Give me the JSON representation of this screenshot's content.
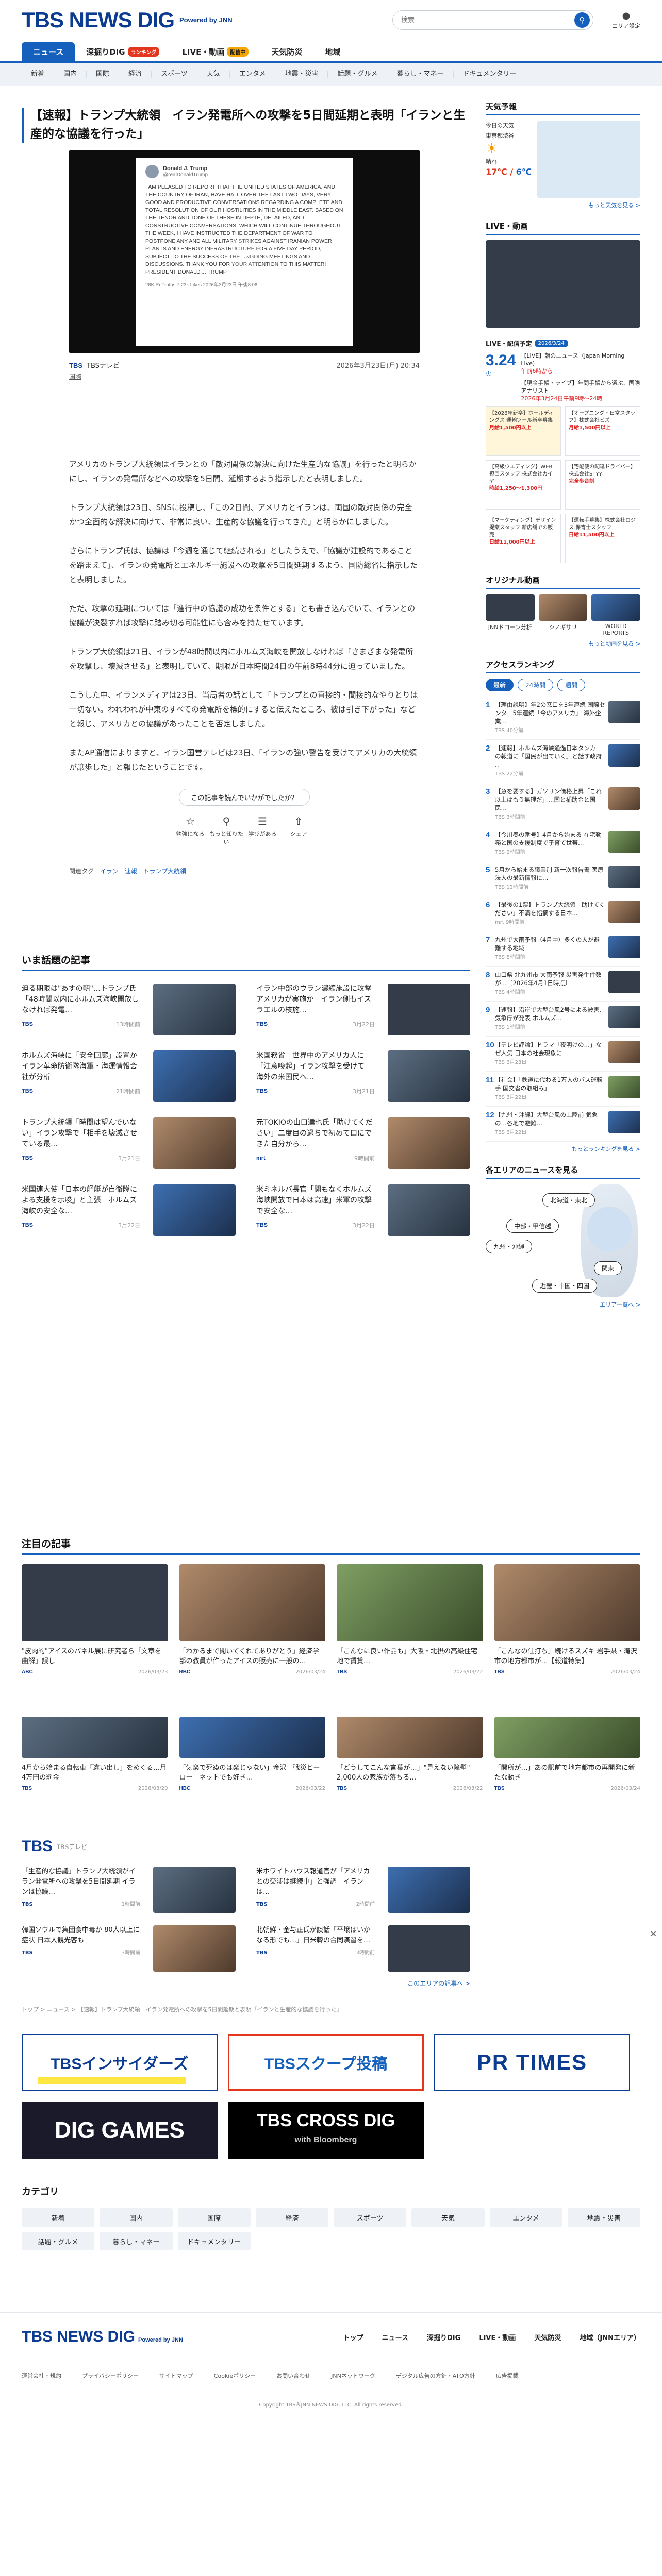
{
  "header": {
    "logo": "TBS NEWS DIG",
    "powered": "Powered by JNN",
    "search_placeholder": "検索",
    "area_label": "エリア設定"
  },
  "nav": {
    "tabs": [
      {
        "label": "ニュース",
        "badge": ""
      },
      {
        "label": "深掘りDIG",
        "badge": "ランキング"
      },
      {
        "label": "LIVE・動画",
        "badge": "配信中"
      },
      {
        "label": "天気防災",
        "badge": ""
      },
      {
        "label": "地域",
        "badge": ""
      }
    ],
    "sub": [
      "新着",
      "国内",
      "国際",
      "経済",
      "スポーツ",
      "天気",
      "エンタメ",
      "地震・災害",
      "話題・グルメ",
      "暮らし・マネー",
      "ドキュメンタリー"
    ]
  },
  "article": {
    "title": "【速報】トランプ大統領　イラン発電所への攻撃を5日間延期と表明「イランと生産的な協議を行った」",
    "tweet": {
      "name": "Donald J. Trump",
      "handle": "@realDonaldTrump",
      "text": "I AM PLEASED TO REPORT THAT THE UNITED STATES OF AMERICA, AND THE COUNTRY OF IRAN, HAVE HAD, OVER THE LAST TWO DAYS, VERY GOOD AND PRODUCTIVE CONVERSATIONS REGARDING A COMPLETE AND TOTAL RESOLUTION OF OUR HOSTILITIES IN THE MIDDLE EAST. BASED ON THE TENOR AND TONE OF THESE IN DEPTH, DETAILED, AND CONSTRUCTIVE CONVERSATIONS, WHICH WILL CONTINUE THROUGHOUT THE WEEK, I HAVE INSTRUCTED THE DEPARTMENT OF WAR TO POSTPONE ANY AND ALL MILITARY STRIKES AGAINST IRANIAN POWER PLANTS AND ENERGY INFRASTRUCTURE FOR A FIVE DAY PERIOD, SUBJECT TO THE SUCCESS OF THE ONGOING MEETINGS AND DISCUSSIONS. THANK YOU FOR YOUR ATTENTION TO THIS MATTER! PRESIDENT DONALD J. TRUMP",
      "meta": "26K ReTruths   7.23k Likes                    2026年3月23日 午後8:06"
    },
    "source": "TBS",
    "source_name": "TBSテレビ",
    "time": "2026年3月23日(月) 20:34",
    "source_link": "国際",
    "paragraphs": [
      "アメリカのトランプ大統領はイランとの「敵対関係の解決に向けた生産的な協議」を行ったと明らかにし、イランの発電所などへの攻撃を5日間、延期するよう指示したと表明しました。",
      "トランプ大統領は23日、SNSに投稿し、「この2日間、アメリカとイランは、両国の敵対関係の完全かつ全面的な解決に向けて、非常に良い、生産的な協議を行ってきた」と明らかにしました。",
      "さらにトランプ氏は、協議は「今週を通じて継続される」としたうえで、「協議が建設的であることを踏まえて」、イランの発電所とエネルギー施設への攻撃を5日間延期するよう、国防総省に指示したと表明しました。",
      "ただ、攻撃の延期については「進行中の協議の成功を条件とする」とも書き込んでいて、イランとの協議が決裂すれば攻撃に踏み切る可能性にも含みを持たせています。",
      "トランプ大統領は21日、イランが48時間以内にホルムズ海峡を開放しなければ「さまざまな発電所を攻撃し、壊滅させる」と表明していて、期限が日本時間24日の午前8時44分に迫っていました。",
      "こうした中、イランメディアは23日、当局者の話として「トランプとの直接的・間接的なやりとりは一切ない。われわれが中東のすべての発電所を標的にすると伝えたところ、彼は引き下がった」などと報じ、アメリカとの協議があったことを否定しました。",
      "またAP通信によりますと、イラン国営テレビは23日、「イランの強い警告を受けてアメリカの大統領が譲歩した」と報じたということです。"
    ],
    "feedback_q": "この記事を読んでいかがでしたか？",
    "reactions": [
      "勉強になる",
      "もっと知りたい",
      "学びがある",
      "シェア"
    ],
    "tags_label": "関連タグ",
    "tags": [
      "イラン",
      "速報",
      "トランプ大統領"
    ]
  },
  "trending": {
    "title": "いま話題の記事",
    "items": [
      {
        "text": "迫る期限は\"あすの朝\"…トランプ氏「48時間以内にホルムズ海峡開放しなければ発電…",
        "src": "TBS",
        "time": "13時間前"
      },
      {
        "text": "イラン中部のウラン濃縮施設に攻撃 アメリカが実施か　イラン側もイスラエルの核施…",
        "src": "TBS",
        "time": "3月22日"
      },
      {
        "text": "ホルムズ海峡に「安全回廊」設置か　イラン革命防衛隊海軍・海運情報会社が分析",
        "src": "TBS",
        "time": "21時間前"
      },
      {
        "text": "米国務省　世界中のアメリカ人に「注意喚起」イラン攻撃を受けて　海外の米国民へ…",
        "src": "TBS",
        "time": "3月21日"
      },
      {
        "text": "トランプ大統領「時間は望んでいない」イラン攻撃で「相手を壊滅させている最…",
        "src": "TBS",
        "time": "3月21日"
      },
      {
        "text": "元TOKIOの山口達也氏「助けてください」二度目の過ちで初めて口にできた自分から…",
        "src": "mrt",
        "time": "9時間前"
      },
      {
        "text": "米国連大使「日本の艦艇が自衛隊による支援を示唆」と主張　ホルムズ海峡の安全な…",
        "src": "TBS",
        "time": "3月22日"
      },
      {
        "text": "米ミネルバ長官「関もなくホルムズ海峡開放で日本は高速」米軍の攻撃で安全な…",
        "src": "TBS",
        "time": "3月22日"
      }
    ]
  },
  "sidebar": {
    "weather": {
      "title": "天気予報",
      "label1": "今日の天気",
      "label2": "東京都渋谷",
      "weather_word": "晴れ",
      "hi": "17℃",
      "lo": "6℃",
      "more": "もっと天気を見る >"
    },
    "live": {
      "title": "LIVE・動画",
      "sched_title": "LIVE・配信予定",
      "sched_pill": "2026/3/24",
      "date": "3.24",
      "date_sub": "火",
      "items": [
        {
          "t": "【LIVE】朝のニュース（Japan Morning Live）",
          "time": "午前6時から"
        },
        {
          "t": "【現金手帳・ライブ】年間手帳から選ぶ、国際アナリスト",
          "time": "2026年3月24日午前9時〜24時"
        }
      ]
    },
    "ads": [
      {
        "t": "【2026年新卒】ホールディングス 運輸ツール新卒募集",
        "sub": "月給1,500円以上"
      },
      {
        "t": "【オープニング・日常スタッフ】株式会社ビズ",
        "sub": "月給1,500円以上"
      },
      {
        "t": "【高級ウエディング】WEB担当スタッフ 株式会社カイヤ",
        "sub": "時給1,250〜1,300円"
      },
      {
        "t": "【宅配便の配達ドライバー】株式会社STYY",
        "sub": "完全歩合制"
      },
      {
        "t": "【マーケティング】デザイン提案スタッフ 新店舗での販売",
        "sub": "日給11,000円以上"
      },
      {
        "t": "【運転手募集】株式会社ロジス 保育士スタッフ",
        "sub": "日給11,500円以上"
      }
    ],
    "series": {
      "title": "オリジナル動画",
      "items": [
        "JNNドローン分析",
        "シノギサリ",
        "WORLD REPORTS"
      ],
      "more": "もっと動画を見る >"
    },
    "ranking": {
      "title": "アクセスランキング",
      "tabs": [
        "最新",
        "24時間",
        "週間"
      ],
      "items": [
        {
          "n": "1",
          "t": "【理由説明】年2の窓口を3年連続 国際センター5年連続「今のアメリカ」 海外企業…",
          "s": "TBS 40分前"
        },
        {
          "n": "2",
          "t": "【速報】ホルムズ海峡通過日本タンカーの報道に「国民が出ていく」と話す政府 ‥",
          "s": "TBS 22分前"
        },
        {
          "n": "3",
          "t": "【急を要する】ガソリン価格上昇「これ以上はもう無理だ」…国と補助金と国民…",
          "s": "TBS 3時間前"
        },
        {
          "n": "4",
          "t": "【今川奏の番号】4月から始まる 在宅勤務と国の支援制度で子育て世帯…",
          "s": "TBS 2時間前"
        },
        {
          "n": "5",
          "t": "5月から始まる職業別 新一次報告書 医療法人の最新情報に…",
          "s": "TBS 12時間前"
        },
        {
          "n": "6",
          "t": "【最後の1票】トランプ大統領「助けてください」不満を指摘する日本…",
          "s": "mrt 9時間前"
        },
        {
          "n": "7",
          "t": "九州で大雨予報（4月中）多くの人が避難する地域",
          "s": "TBS 8時間前"
        },
        {
          "n": "8",
          "t": "山口県 北九州市 大雨予報 災害発生件数が…〔2026年4月1日時点〕",
          "s": "TBS 4時間前"
        },
        {
          "n": "9",
          "t": "【速報】沿岸で大型台風2号による被害、気象庁が発表 ホルムズ…",
          "s": "TBS 1時間前"
        },
        {
          "n": "10",
          "t": "【テレビ評論】ドラマ「夜明けの…」なぜ人気 日本の社会現象に",
          "s": "TBS 3月23日"
        },
        {
          "n": "11",
          "t": "【社会】「鉄道に代わる1万人のバス運転手 国交省の取組み」",
          "s": "TBS 3月22日"
        },
        {
          "n": "12",
          "t": "【九州・沖縄】大型台風の上陸前 気象の…各地で避難…",
          "s": "TBS 3月22日"
        }
      ],
      "more": "もっとランキングを見る >"
    },
    "areamap": {
      "title": "各エリアのニュースを見る",
      "pills": [
        "北海道・東北",
        "中部・甲信越",
        "九州・沖縄",
        "関東",
        "近畿・中国・四国"
      ],
      "more": "エリア一覧へ >"
    }
  },
  "featured": {
    "title": "注目の記事",
    "row1": [
      {
        "t": "\"皮肉的\"アイスのパネル展に研究者ら「文章を曲解」誤し"
      },
      {
        "t": "「わかるまで聞いてくれてありがとう」経済学部の教員が作ったアイスの販売に一般の…"
      },
      {
        "t": "「こんなに良い作品も」大阪・北摂の高級住宅地で賃貸…"
      },
      {
        "t": "「こんなの仕打ち」続けるスズキ 岩手県・滝沢市の地方都市が…【報道特集】"
      }
    ],
    "row1_src": [
      {
        "s": "ABC",
        "d": "2026/03/23"
      },
      {
        "s": "RBC",
        "d": "2026/03/24"
      },
      {
        "s": "TBS",
        "d": "2026/03/22"
      },
      {
        "s": "TBS",
        "d": "2026/03/24"
      }
    ],
    "row2": [
      {
        "t": "4月から始まる自転車「違い出し」をめぐる…月4万円の罰金"
      },
      {
        "t": "「気楽で死ぬのは楽じゃない」金沢　戦災ヒーロー　ネットでも好き…"
      },
      {
        "t": "「どうしてこんな言葉が…」\"見えない障壁\" 2,000人の家族が落ちる…"
      },
      {
        "t": "「関所が…」あの駅前で地方都市の再開発に新たな動き"
      }
    ],
    "row2_src": [
      {
        "s": "TBS",
        "d": "2026/03/20"
      },
      {
        "s": "HBC",
        "d": "2026/03/22"
      },
      {
        "s": "TBS",
        "d": "2026/03/22"
      },
      {
        "s": "TBS",
        "d": "2026/03/24"
      }
    ]
  },
  "tbs": {
    "title": "TBS",
    "sub": "TBSテレビ",
    "items": [
      {
        "t": "「生産的な協議」トランプ大統領がイラン発電所への攻撃を5日間延期 イランは協議…",
        "s": "TBS",
        "d": "1時間前"
      },
      {
        "t": "米ホワイトハウス報道官が「アメリカとの交渉は継続中」と強調　イランは…",
        "s": "TBS",
        "d": "2時間前"
      },
      {
        "t": "韓国ソウルで集団食中毒か 80人以上に症状 日本人観光客も",
        "s": "TBS",
        "d": "3時間前"
      },
      {
        "t": "北朝鮮・金与正氏が談話「平壌はいかなる形でも…」日米韓の合同演習を…",
        "s": "TBS",
        "d": "3時間前"
      }
    ],
    "more": "このエリアの記事へ >"
  },
  "crumb": "トップ  >  ニュース  >  【速報】トランプ大統領　イラン発電所への攻撃を5日間延期と表明「イランと生産的な協議を行った」",
  "banners": {
    "insiders": "TBSインサイダーズ",
    "insiders_sub": "話題の情報収集目的を見てます",
    "scoop": "TBSスクープ投稿",
    "prtimes": "PR TIMES",
    "diggames": "DIG GAMES",
    "crossdig": "TBS CROSS DIG",
    "crossdig_sub": "with Bloomberg"
  },
  "categories": {
    "title": "カテゴリ",
    "items": [
      "新着",
      "国内",
      "国際",
      "経済",
      "スポーツ",
      "天気",
      "エンタメ",
      "地震・災害",
      "話題・グルメ",
      "暮らし・マネー",
      "ドキュメンタリー"
    ]
  },
  "footer": {
    "logo": "TBS NEWS DIG",
    "logo_sub": "Powered by JNN",
    "nav": [
      "トップ",
      "ニュース",
      "深掘りDIG",
      "LIVE・動画",
      "天気防災",
      "地域（JNNエリア）"
    ],
    "links": [
      "運営会社・規約",
      "プライバシーポリシー",
      "サイトマップ",
      "Cookieポリシー",
      "お問い合わせ",
      "JNNネットワーク",
      "デジタル広告の方針・ATO方針",
      "広告掲載"
    ],
    "copy": "Copyright TBS＆JNN NEWS DIG, LLC. All rights reserved."
  }
}
